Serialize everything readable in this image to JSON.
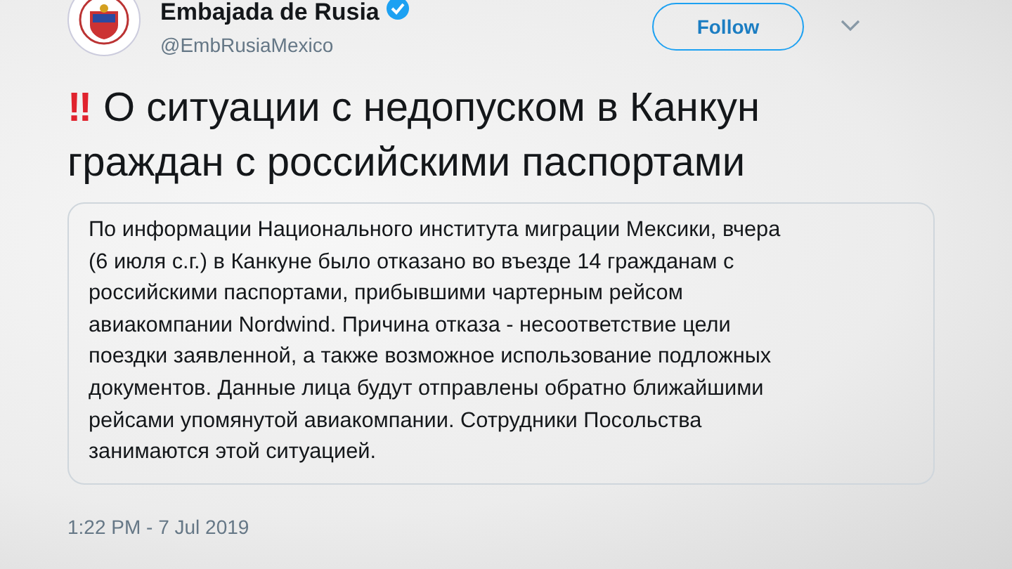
{
  "author": {
    "name": "Embajada de Rusia",
    "verified": true,
    "handle": "@EmbRusiaMexico"
  },
  "follow_button": "Follow",
  "heading": {
    "emoji": "‼",
    "text": "О ситуации с недопуском в Канкун\nграждан с российскими паспортами"
  },
  "quote": "По информации Национального института миграции Мексики, вчера\n(6 июля с.г.) в Канкуне было отказано во въезде 14 гражданам с\nроссийскими паспортами, прибывшими чартерным рейсом\nавиакомпании Nordwind. Причина отказа - несоответствие цели\nпоездки заявленной, а также возможное использование подложных\nдокументов. Данные лица будут отправлены обратно ближайшими\nрейсами упомянутой авиакомпании. Сотрудники Посольства\nзанимаются этой ситуацией.",
  "timestamp": "1:22 PM - 7 Jul 2019"
}
